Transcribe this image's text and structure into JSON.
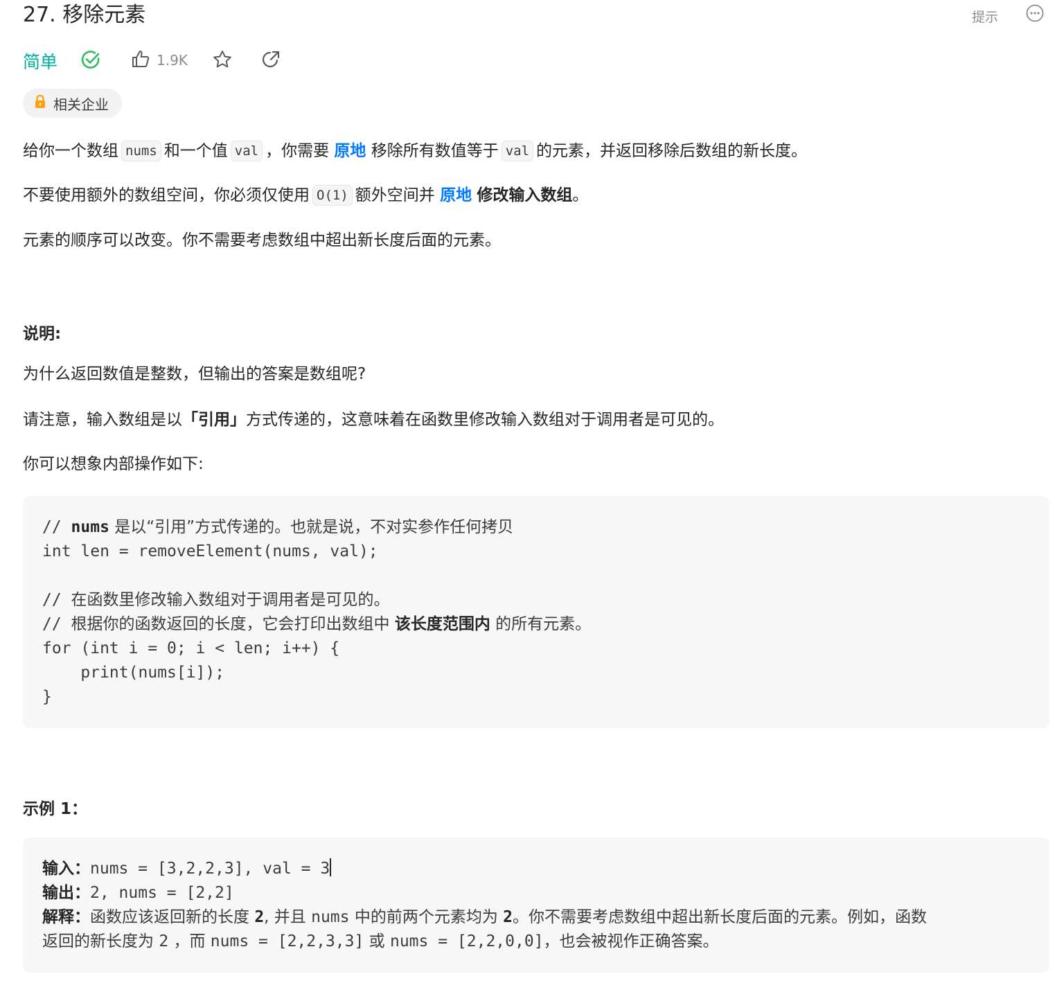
{
  "problem": {
    "title": "27. 移除元素",
    "hint_label": "提示",
    "difficulty": "简单",
    "likes": "1.9K",
    "company_tag": "相关企业"
  },
  "description": {
    "p1": [
      "给你一个数组",
      "nums",
      "和一个值",
      "val",
      "，你需要",
      "原地",
      "移除所有数值等于",
      "val",
      "的元素，并返回移除后数组的新长度。"
    ],
    "p2": [
      "不要使用额外的数组空间，你必须仅使用",
      "O(1)",
      "额外空间并",
      "原地",
      "修改输入数组",
      "。"
    ],
    "p3": "元素的顺序可以改变。你不需要考虑数组中超出新长度后面的元素。"
  },
  "explanation": {
    "heading": "说明:",
    "q": "为什么返回数值是整数，但输出的答案是数组呢?",
    "note": [
      "请注意，输入数组是以",
      "「引用」",
      "方式传递的，这意味着在函数里修改输入数组对于调用者是可见的。"
    ],
    "imagine": "你可以想象内部操作如下:"
  },
  "code": {
    "l1_prefix": "// ",
    "l1_bold": "nums",
    "l1_text": " 是以“引用”方式传递的。也就是说，不对实参作任何拷贝",
    "l2": "int len = removeElement(nums, val);",
    "l4_prefix": "// ",
    "l4_text": "在函数里修改输入数组对于调用者是可见的。",
    "l5_prefix": "// ",
    "l5_text": "根据你的函数返回的长度，它会打印出数组中 ",
    "l5_bold": "该长度范围内",
    "l5_tail": " 的所有元素。",
    "l6": "for (int i = 0; i < len; i++) {",
    "l7": "    print(nums[i]);",
    "l8": "}"
  },
  "example1": {
    "heading": "示例 1：",
    "input_label": "输入：",
    "input_value": "nums = [3,2,2,3], val = 3",
    "output_label": "输出：",
    "output_value": "2, nums = [2,2]",
    "explain_label": "解释：",
    "explain_l1": [
      "函数应该返回新的长度",
      "2",
      ", 并且",
      "nums",
      "中的前两个元素均为",
      "2",
      "。你不需要考虑数组中超出新长度后面的元素。例如，函数"
    ],
    "explain_l2": [
      "返回的新长度为",
      "2",
      "，而",
      "nums = [2,2,3,3]",
      "或",
      "nums = [2,2,0,0]",
      "，也会被视作正确答案。"
    ]
  },
  "colors": {
    "accent_easy": "#00af9b",
    "accent_blue": "#007aff",
    "lock": "#ffa116"
  }
}
